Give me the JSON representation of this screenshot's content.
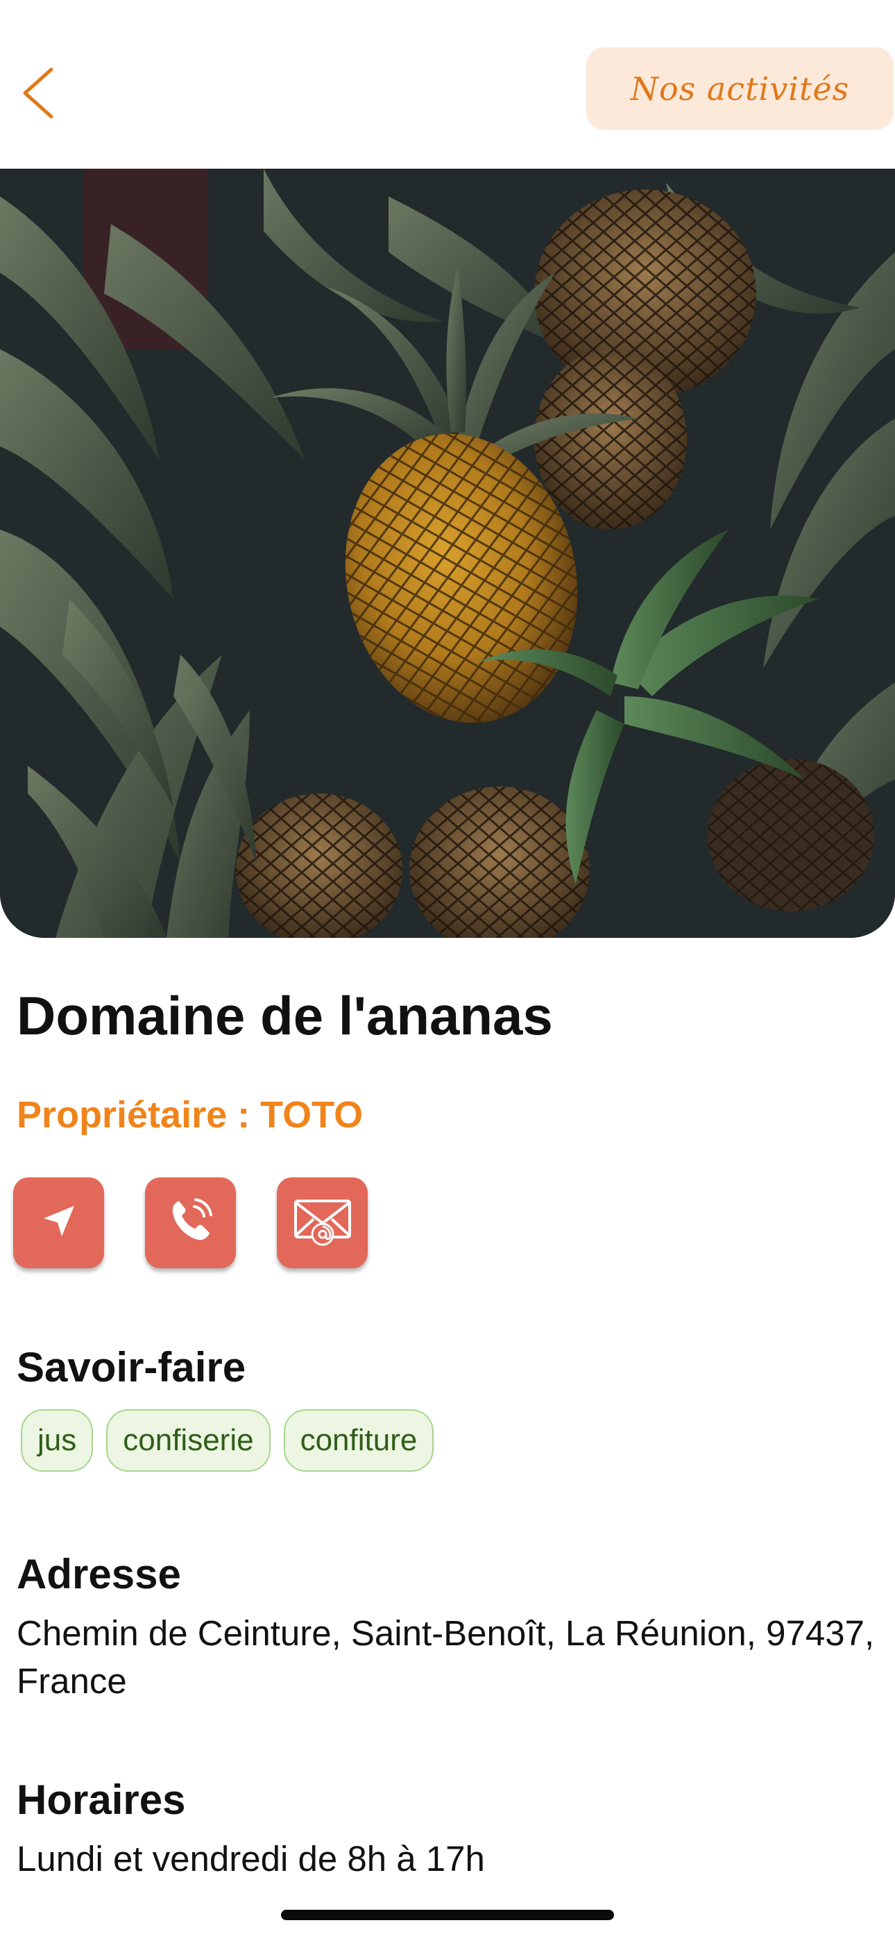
{
  "header": {
    "back_icon": "chevron-left-icon",
    "activities_label": "Nos activités",
    "accent_color": "#e0781a",
    "activities_bg": "#fce9d9"
  },
  "hero": {
    "image_subject": "photo of pineapples with green leaves"
  },
  "place": {
    "name": "Domaine de l'ananas",
    "owner": "Propriétaire : TOTO",
    "owner_color": "#f0841b"
  },
  "actions": [
    {
      "icon": "navigation-arrow-icon"
    },
    {
      "icon": "phone-icon"
    },
    {
      "icon": "envelope-at-icon"
    }
  ],
  "action_color": "#e2685a",
  "savoir_faire": {
    "heading": "Savoir-faire",
    "tags": [
      "jus",
      "confiserie",
      "confiture"
    ],
    "tag_colors": {
      "bg": "#ecf6e3",
      "border": "#a9d48e",
      "text": "#2f5d17"
    }
  },
  "address": {
    "heading": "Adresse",
    "value": "Chemin de Ceinture, Saint-Benoît, La Réunion, 97437, France"
  },
  "hours": {
    "heading": "Horaires",
    "value": "Lundi et vendredi de 8h à 17h"
  }
}
